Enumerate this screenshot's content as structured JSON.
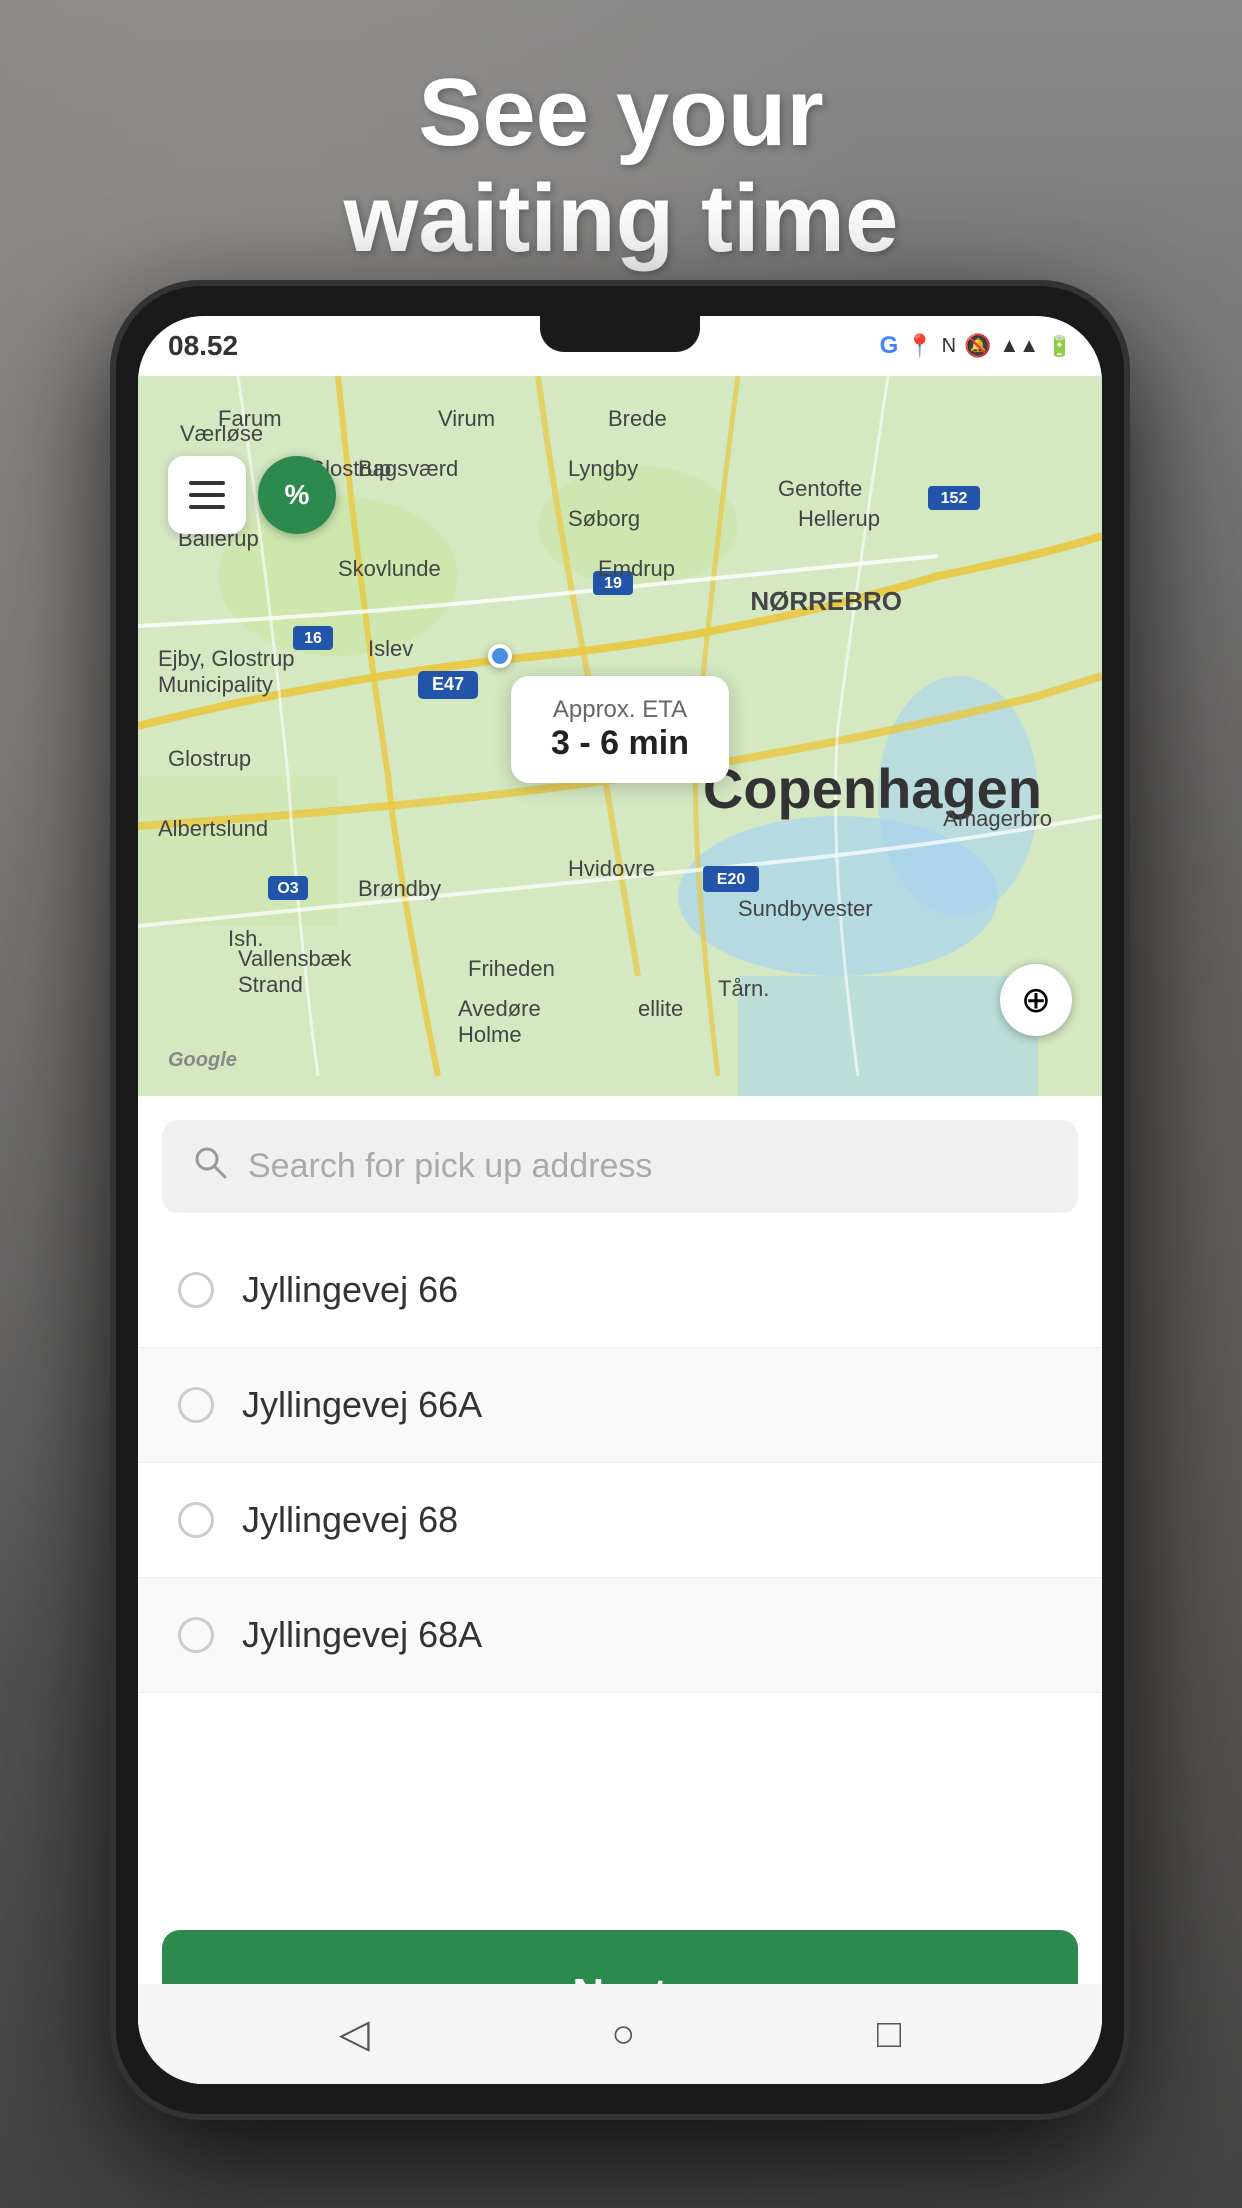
{
  "hero": {
    "title_line1": "See your",
    "title_line2": "waiting time"
  },
  "status_bar": {
    "time": "08.52",
    "icons": "NFC ▲▲ 4G+"
  },
  "map": {
    "eta_label": "Approx. ETA",
    "eta_time": "3 - 6 min",
    "copenhagen_label": "Copenhagen",
    "norrebro_label": "NØRREBRO",
    "amagerbro_label": "Amagerbro",
    "glostrup_label": "Glostrup",
    "islev_label": "Islev",
    "ejby_label": "Ejby, Glostrup\nMunicipality",
    "albertslund_label": "Albertslund",
    "brondby_label": "Brøndby",
    "hvidovre_label": "Hvidovre",
    "google_logo": "Google"
  },
  "discount_badge": {
    "text": "%"
  },
  "search": {
    "placeholder": "Search for pick up address"
  },
  "addresses": [
    {
      "label": "Jyllingevej 66"
    },
    {
      "label": "Jyllingevej 66A"
    },
    {
      "label": "Jyllingevej 68"
    },
    {
      "label": "Jyllingevej 68A"
    }
  ],
  "next_button": {
    "label": "Next"
  },
  "nav": {
    "back_icon": "◁",
    "home_icon": "○",
    "apps_icon": "□"
  }
}
